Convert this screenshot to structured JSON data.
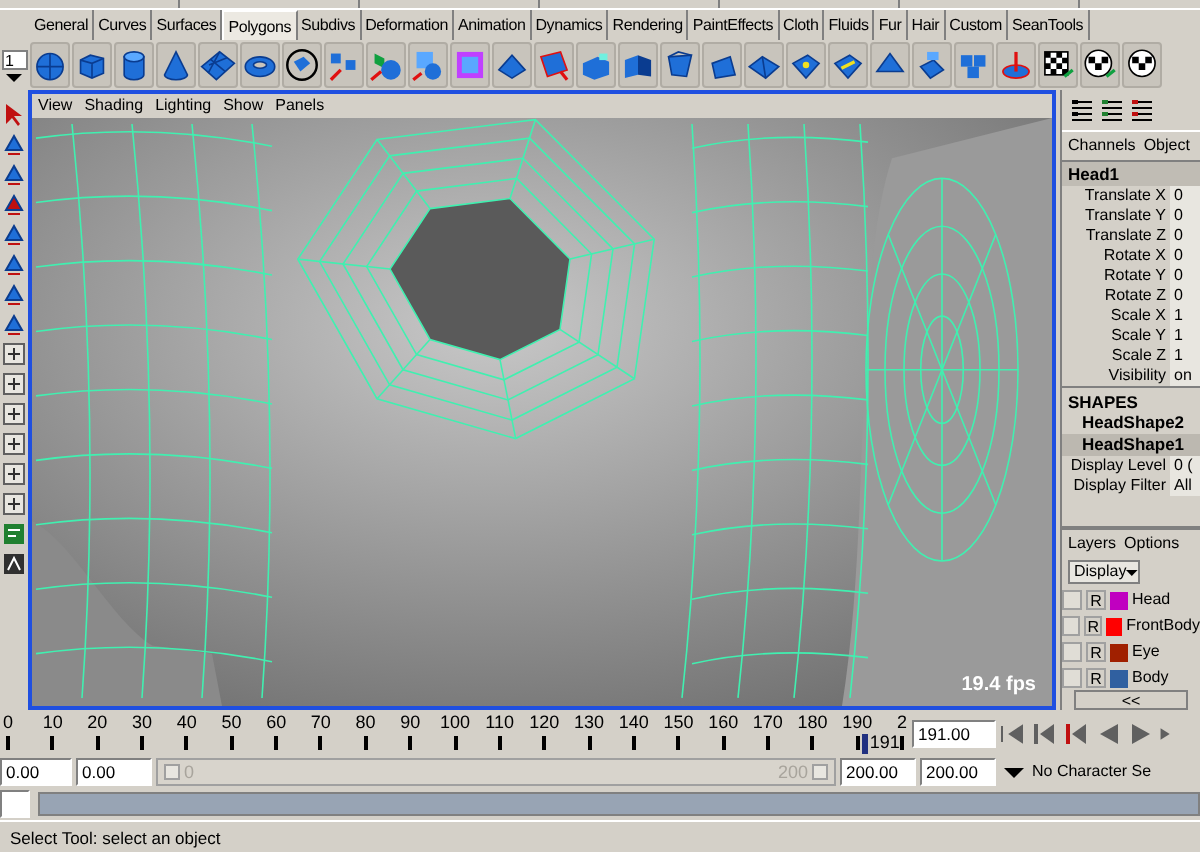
{
  "shelf_tabs": [
    {
      "label": "General",
      "selected": false
    },
    {
      "label": "Curves",
      "selected": false
    },
    {
      "label": "Surfaces",
      "selected": false
    },
    {
      "label": "Polygons",
      "selected": true
    },
    {
      "label": "Subdivs",
      "selected": false
    },
    {
      "label": "Deformation",
      "selected": false
    },
    {
      "label": "Animation",
      "selected": false
    },
    {
      "label": "Dynamics",
      "selected": false
    },
    {
      "label": "Rendering",
      "selected": false
    },
    {
      "label": "PaintEffects",
      "selected": false
    },
    {
      "label": "Cloth",
      "selected": false
    },
    {
      "label": "Fluids",
      "selected": false
    },
    {
      "label": "Fur",
      "selected": false
    },
    {
      "label": "Hair",
      "selected": false
    },
    {
      "label": "Custom",
      "selected": false
    },
    {
      "label": "SeanTools",
      "selected": false
    }
  ],
  "shelf": {
    "number": "1"
  },
  "viewport": {
    "menu": [
      "View",
      "Shading",
      "Lighting",
      "Show",
      "Panels"
    ],
    "fps": "19.4 fps"
  },
  "channel_box": {
    "menu": [
      "Channels",
      "Object"
    ],
    "node": "Head1",
    "attributes": [
      {
        "name": "Translate X",
        "value": "0"
      },
      {
        "name": "Translate Y",
        "value": "0"
      },
      {
        "name": "Translate Z",
        "value": "0"
      },
      {
        "name": "Rotate X",
        "value": "0"
      },
      {
        "name": "Rotate Y",
        "value": "0"
      },
      {
        "name": "Rotate Z",
        "value": "0"
      },
      {
        "name": "Scale X",
        "value": "1"
      },
      {
        "name": "Scale Y",
        "value": "1"
      },
      {
        "name": "Scale Z",
        "value": "1"
      },
      {
        "name": "Visibility",
        "value": "on"
      }
    ],
    "shapes_heading": "SHAPES",
    "shapes": [
      {
        "label": "HeadShape2",
        "selected": false
      },
      {
        "label": "HeadShape1",
        "selected": true
      }
    ],
    "shape_attributes": [
      {
        "name": "Display Level",
        "value": "0 ("
      },
      {
        "name": "Display Filter",
        "value": "All"
      }
    ]
  },
  "layers": {
    "menu": [
      "Layers",
      "Options"
    ],
    "display": "Display",
    "items": [
      {
        "flag": "R",
        "name": "Head",
        "color": "#c000c0"
      },
      {
        "flag": "R",
        "name": "FrontBody",
        "color": "#ff0000"
      },
      {
        "flag": "R",
        "name": "Eye",
        "color": "#a02000"
      },
      {
        "flag": "R",
        "name": "Body",
        "color": "#3060a0"
      }
    ],
    "collapse": "<<"
  },
  "time_slider": {
    "ticks": [
      "0",
      "10",
      "20",
      "30",
      "40",
      "50",
      "60",
      "70",
      "80",
      "90",
      "100",
      "110",
      "120",
      "130",
      "140",
      "150",
      "160",
      "170",
      "180",
      "190",
      "2"
    ],
    "current": "191",
    "level": 0.955,
    "field": "191.00"
  },
  "range": {
    "level": 1,
    "start": "0.00",
    "inner_start": "0.00",
    "slider_start": "0",
    "slider_end": "200",
    "inner_end": "200.00",
    "end": "200.00",
    "character_set": "No Character Se"
  },
  "help_line": "Select Tool: select an object"
}
